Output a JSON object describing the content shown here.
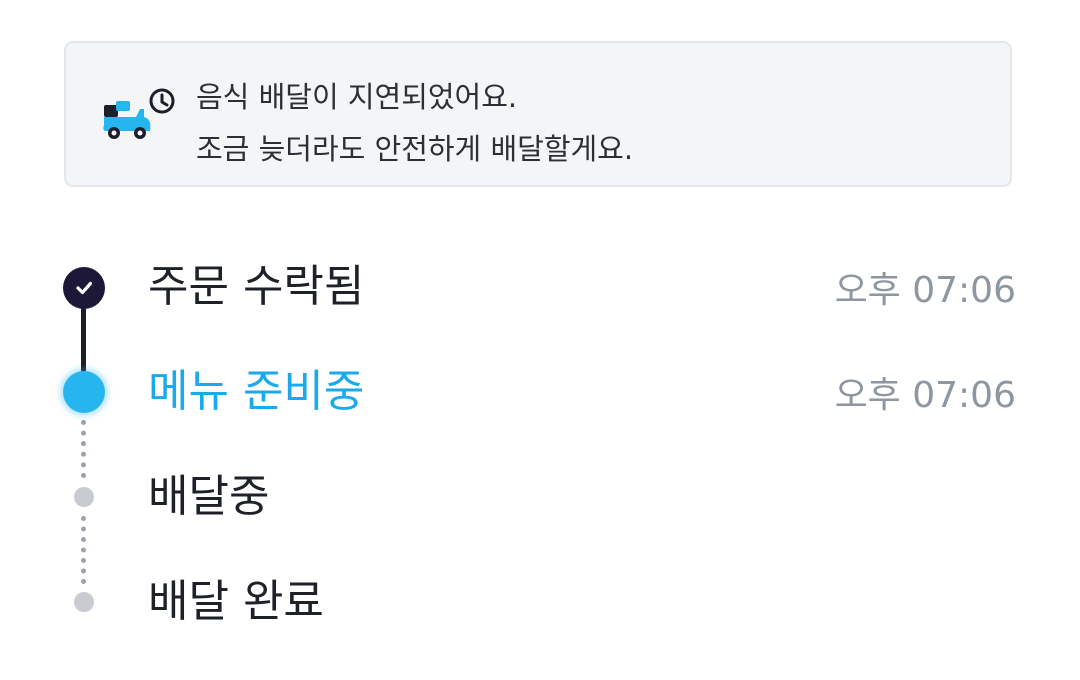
{
  "notice": {
    "icon": "scooter-clock-icon",
    "line1": "음식 배달이 지연되었어요.",
    "line2": "조금 늦더라도 안전하게 배달할게요."
  },
  "steps": [
    {
      "label": "주문 수락됨",
      "time": "오후 07:06",
      "status": "done"
    },
    {
      "label": "메뉴 준비중",
      "time": "오후 07:06",
      "status": "current"
    },
    {
      "label": "배달중",
      "time": "",
      "status": "pending"
    },
    {
      "label": "배달 완료",
      "time": "",
      "status": "pending"
    }
  ],
  "colors": {
    "accent": "#1aa9ea",
    "done_dot": "#1d1838",
    "pending_dot": "#c8cbd0",
    "notice_bg": "#f4f5f7"
  }
}
